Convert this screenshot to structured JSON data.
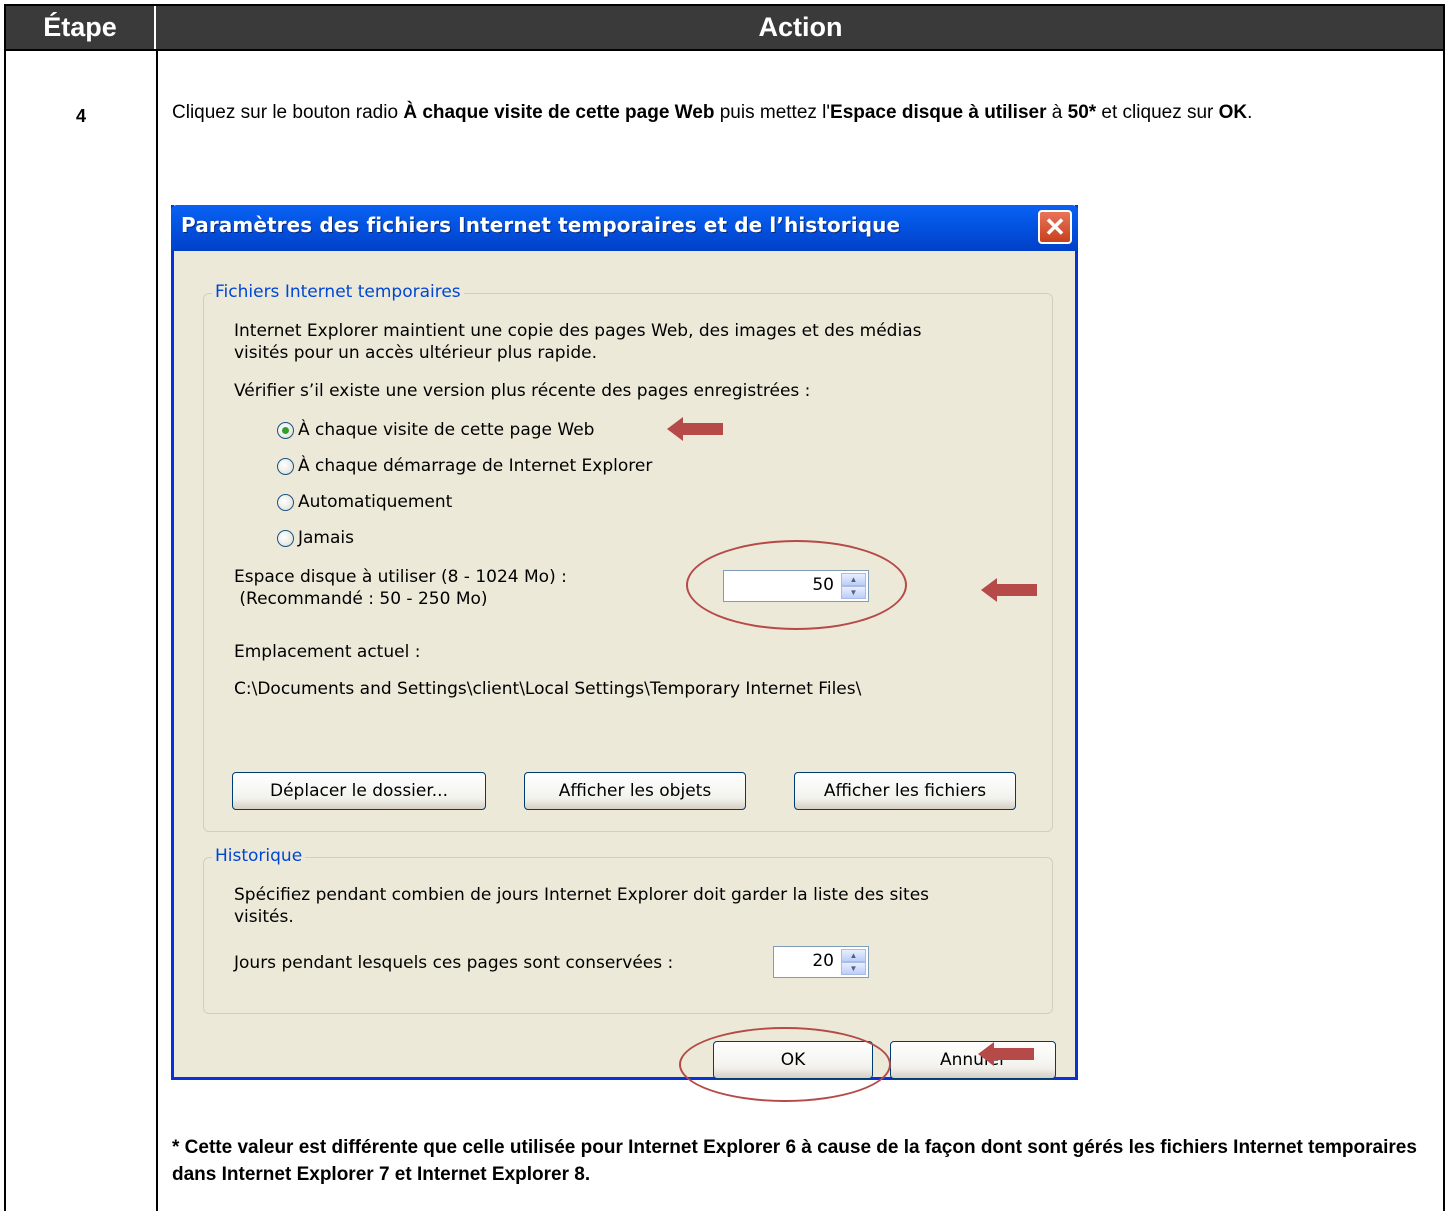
{
  "table": {
    "header_step": "Étape",
    "header_action": "Action",
    "step_number": "4",
    "instruction": {
      "part1": "Cliquez sur le bouton radio ",
      "bold1": "À chaque visite de cette page Web",
      "part2": " puis mettez l'",
      "bold2": "Espace disque à utiliser",
      "part3": " à ",
      "bold3": "50*",
      "part4": " et cliquez sur ",
      "bold4": "OK",
      "part5": "."
    },
    "footnote": "* Cette valeur est différente que celle utilisée pour Internet Explorer 6 à cause de la façon dont sont gérés les fichiers Internet temporaires dans Internet Explorer 7 et Internet Explorer 8."
  },
  "dialog": {
    "title": "Paramètres des fichiers Internet temporaires et de l’historique",
    "temp_files": {
      "legend": "Fichiers Internet temporaires",
      "description_line1": "Internet Explorer maintient une copie des pages Web, des images et des médias",
      "description_line2": "visités pour un accès ultérieur plus rapide.",
      "check_label": "Vérifier s’il existe une version plus récente des pages enregistrées :",
      "radio_options": [
        {
          "label": "À chaque visite de cette page Web",
          "checked": true
        },
        {
          "label": "À chaque démarrage de Internet Explorer",
          "checked": false
        },
        {
          "label": "Automatiquement",
          "checked": false
        },
        {
          "label": "Jamais",
          "checked": false
        }
      ],
      "disk_space_label_line1": "Espace disque à utiliser (8 - 1024 Mo) :",
      "disk_space_label_line2": " (Recommandé : 50 - 250 Mo)",
      "disk_space_value": "50",
      "location_label": "Emplacement actuel :",
      "location_path": "C:\\Documents and Settings\\client\\Local Settings\\Temporary Internet Files\\",
      "move_folder_button": "Déplacer le dossier...",
      "view_objects_button": "Afficher les objets",
      "view_files_button": "Afficher les fichiers"
    },
    "history": {
      "legend": "Historique",
      "description_line1": "Spécifiez pendant combien de jours Internet Explorer doit garder la liste des sites",
      "description_line2": "visités.",
      "days_label": "Jours pendant lesquels ces pages sont conservées :",
      "days_value": "20"
    },
    "ok_button": "OK",
    "cancel_button": "Annuler"
  },
  "colors": {
    "annotation": "#b54a48",
    "header_bg": "#3a3a3a",
    "dialog_bg": "#ece9d8",
    "titlebar": "#0353e2"
  }
}
